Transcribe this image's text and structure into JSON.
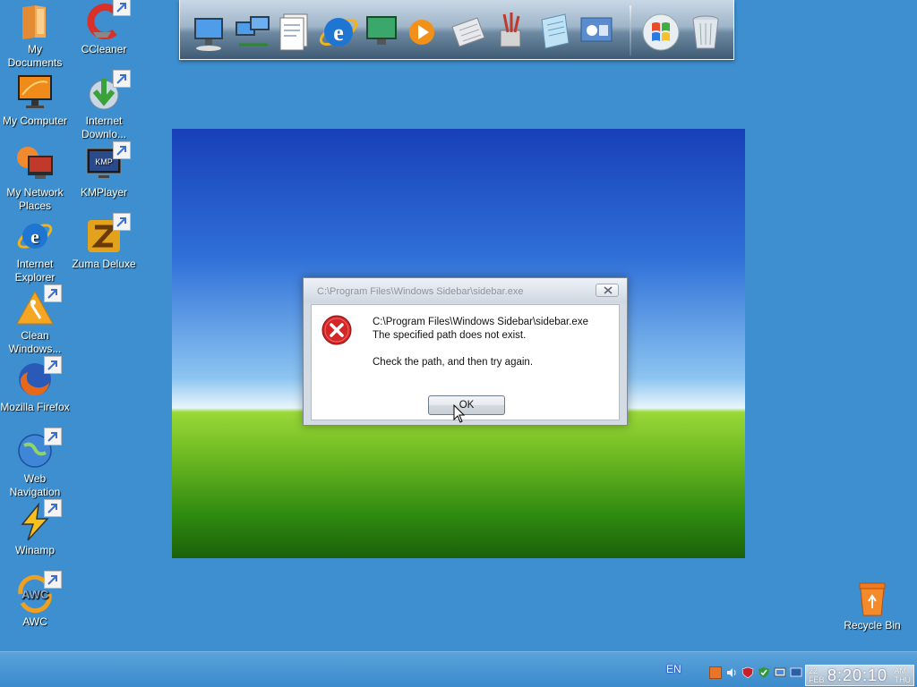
{
  "desktop": {
    "left_icons": [
      {
        "label": "My Documents",
        "icon": "folder-icon"
      },
      {
        "label": "My Computer",
        "icon": "monitor-icon"
      },
      {
        "label": "My Network Places",
        "icon": "network-icon"
      },
      {
        "label": "Internet Explorer",
        "icon": "ie-icon"
      },
      {
        "label": "Clean Windows...",
        "icon": "broom-warning-icon"
      },
      {
        "label": "Mozilla Firefox",
        "icon": "firefox-icon"
      },
      {
        "label": "Web Navigation",
        "icon": "globe-icon"
      },
      {
        "label": "Winamp",
        "icon": "winamp-icon"
      },
      {
        "label": "AWC",
        "icon": "awc-icon"
      }
    ],
    "right_icons": [
      {
        "label": "CCleaner",
        "icon": "ccleaner-icon"
      },
      {
        "label": "Internet Downlo...",
        "icon": "download-manager-icon"
      },
      {
        "label": "KMPlayer",
        "icon": "kmplayer-icon"
      },
      {
        "label": "Zuma Deluxe",
        "icon": "zuma-icon"
      }
    ],
    "recycle_bin": {
      "label": "Recycle Bin",
      "icon": "recycle-bin-icon"
    }
  },
  "dock": {
    "items": [
      "computer-icon",
      "network-computers-icon",
      "documents-icon",
      "internet-explorer-icon",
      "media-center-icon",
      "media-player-icon",
      "calculator-icon",
      "paint-icon",
      "notepad-icon",
      "control-panel-icon",
      "windows-start-icon",
      "trash-icon"
    ]
  },
  "dialog": {
    "title": "C:\\Program Files\\Windows Sidebar\\sidebar.exe",
    "line1": "C:\\Program Files\\Windows Sidebar\\sidebar.exe",
    "line2": "The specified path does not exist.",
    "line3": "Check the path, and then try again.",
    "ok_label": "OK"
  },
  "taskbar": {
    "language": "EN",
    "clock": {
      "day_num": "22",
      "month": "FEB",
      "time": "8:20:10",
      "meridiem": "AM",
      "weekday": "THU"
    }
  },
  "colors": {
    "desktop_bg": "#3d8fd0",
    "error_red": "#d42626"
  }
}
